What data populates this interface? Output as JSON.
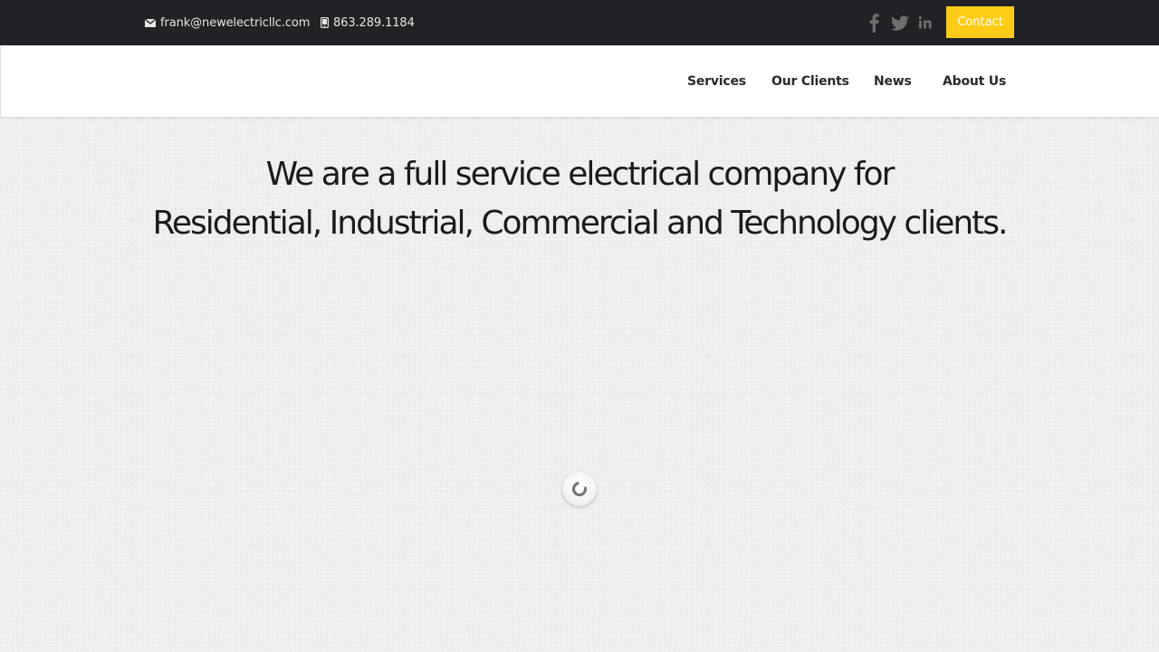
{
  "topbar": {
    "email": "frank@newelectricllc.com",
    "email_icon": "envelope-icon",
    "phone": "863.289.1184",
    "phone_icon": "mobile-phone-icon",
    "social": [
      {
        "icon": "facebook-icon"
      },
      {
        "icon": "twitter-icon"
      },
      {
        "icon": "linkedin-icon"
      }
    ],
    "contact_label": "Contact",
    "contact_color": "#fecc17",
    "background": "#212225"
  },
  "nav": {
    "items": [
      {
        "label": "Services"
      },
      {
        "label": "Our Clients"
      },
      {
        "label": "News"
      },
      {
        "label": "About Us"
      }
    ]
  },
  "hero": {
    "line1": "We are a full service electrical company for",
    "line2": "Residential, Industrial, Commercial and Technology clients."
  },
  "loader": {
    "icon": "loading-spinner-icon"
  }
}
